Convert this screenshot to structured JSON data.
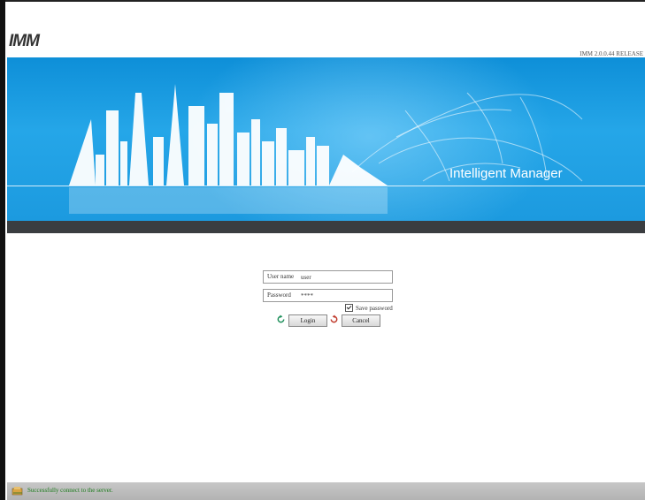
{
  "header": {
    "logo_text": "IMM",
    "version": "IMM 2.0.0.44 RELEASE"
  },
  "banner": {
    "title": "Intelligent Manager"
  },
  "login": {
    "username_label": "User name",
    "username_value": "user",
    "password_label": "Password",
    "password_value": "****",
    "save_password_label": "Save password",
    "save_password_checked": true,
    "login_button": "Login",
    "cancel_button": "Cancel"
  },
  "status": {
    "message": "Successfully connect to the server."
  },
  "colors": {
    "banner": "#1c9adf",
    "status_text": "#1a7a1a"
  }
}
